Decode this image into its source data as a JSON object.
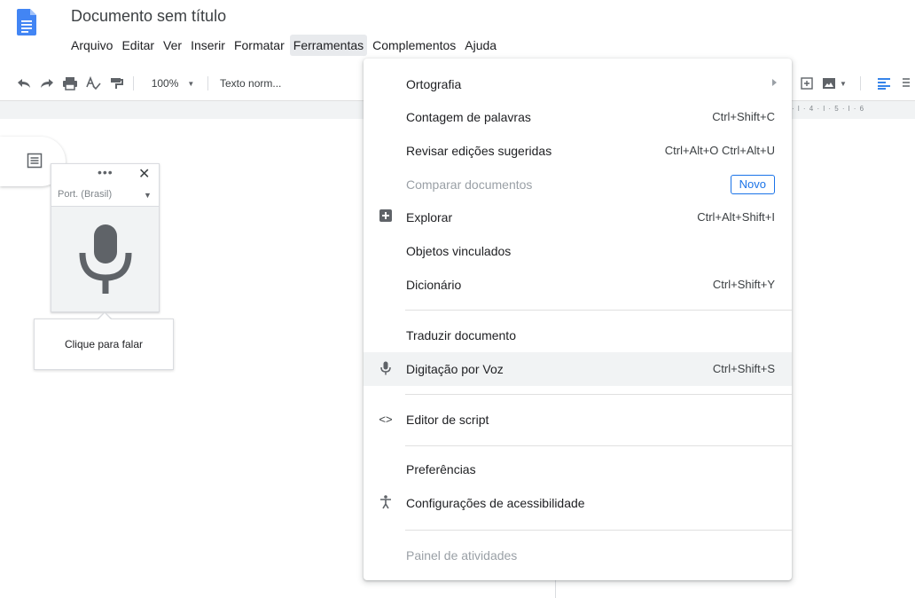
{
  "app": {
    "doc_title": "Documento sem título",
    "accent_color": "#1a73e8"
  },
  "menubar": {
    "items": [
      "Arquivo",
      "Editar",
      "Ver",
      "Inserir",
      "Formatar",
      "Ferramentas",
      "Complementos",
      "Ajuda"
    ],
    "active_item": "Ferramentas"
  },
  "toolbar": {
    "zoom": "100%",
    "style": "Texto norm...",
    "icons": [
      "undo-icon",
      "redo-icon",
      "print-icon",
      "spellcheck-icon",
      "paint-format-icon",
      "insert-link-icon",
      "insert-image-icon",
      "align-left-icon"
    ]
  },
  "ruler": {
    "text": "· l · 4 · l · 5 · l · 6"
  },
  "voice_widget": {
    "language": "Port. (Brasil)",
    "tooltip": "Clique para falar"
  },
  "tools_menu": {
    "spelling": "Ortografia",
    "word_count": "Contagem de palavras",
    "word_count_shortcut": "Ctrl+Shift+C",
    "review_suggestions": "Revisar edições sugeridas",
    "review_suggestions_shortcut": "Ctrl+Alt+O Ctrl+Alt+U",
    "compare_docs": "Comparar documentos",
    "compare_docs_badge": "Novo",
    "explore": "Explorar",
    "explore_shortcut": "Ctrl+Alt+Shift+I",
    "linked_objects": "Objetos vinculados",
    "dictionary": "Dicionário",
    "dictionary_shortcut": "Ctrl+Shift+Y",
    "translate": "Traduzir documento",
    "voice_typing": "Digitação por Voz",
    "voice_typing_shortcut": "Ctrl+Shift+S",
    "script_editor": "Editor de script",
    "preferences": "Preferências",
    "accessibility": "Configurações de acessibilidade",
    "activity_dashboard": "Painel de atividades"
  }
}
